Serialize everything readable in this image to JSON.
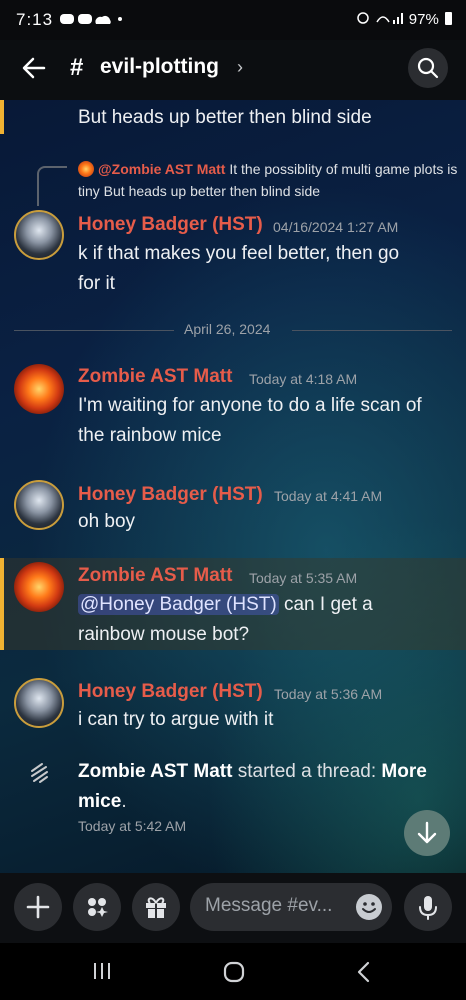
{
  "status_bar": {
    "time": "7:13",
    "battery": "97%"
  },
  "header": {
    "channel_hash": "#",
    "channel_name": "evil-plotting",
    "chevron": "›"
  },
  "messages": {
    "truncated_text": "But heads up better then blind side",
    "reply": {
      "author": "@Zombie AST Matt",
      "text": "It the possiblity of multi game plots is tiny  But heads up better then blind side"
    },
    "m1": {
      "author": "Honey Badger (HST)",
      "time": "04/16/2024 1:27 AM",
      "line1": "k if that makes you feel better, then go",
      "line2": "for it"
    },
    "divider": "April 26, 2024",
    "m2": {
      "author": "Zombie AST Matt",
      "time": "Today at 4:18 AM",
      "line1": "I'm waiting for anyone to do a life scan of",
      "line2": "the rainbow mice"
    },
    "m3": {
      "author": "Honey Badger (HST)",
      "time": "Today at 4:41 AM",
      "line1": "oh boy"
    },
    "m4": {
      "author": "Zombie AST Matt",
      "time": "Today at 5:35 AM",
      "mention": "@Honey Badger (HST)",
      "line1_rest": "can I get a",
      "line2": "rainbow mouse bot?"
    },
    "m5": {
      "author": "Honey Badger (HST)",
      "time": "Today at 5:36 AM",
      "line1": "i can try to argue with it"
    },
    "thread": {
      "author": "Zombie AST Matt",
      "action": "started a thread:",
      "thread_name_1": "More",
      "thread_name_2": "mice",
      "period": ".",
      "time": "Today at 5:42 AM"
    }
  },
  "composer": {
    "placeholder": "Message #ev..."
  },
  "colors": {
    "name_red": "#e65c4a",
    "mention_bg": "#5865f2",
    "highlight_bar": "#f0b232"
  },
  "icons": [
    "back-arrow-icon",
    "search-icon",
    "plus-icon",
    "apps-icon",
    "gift-icon",
    "emoji-icon",
    "mic-icon",
    "thread-icon",
    "arrow-down-icon",
    "recents-icon",
    "home-icon",
    "back-nav-icon"
  ]
}
